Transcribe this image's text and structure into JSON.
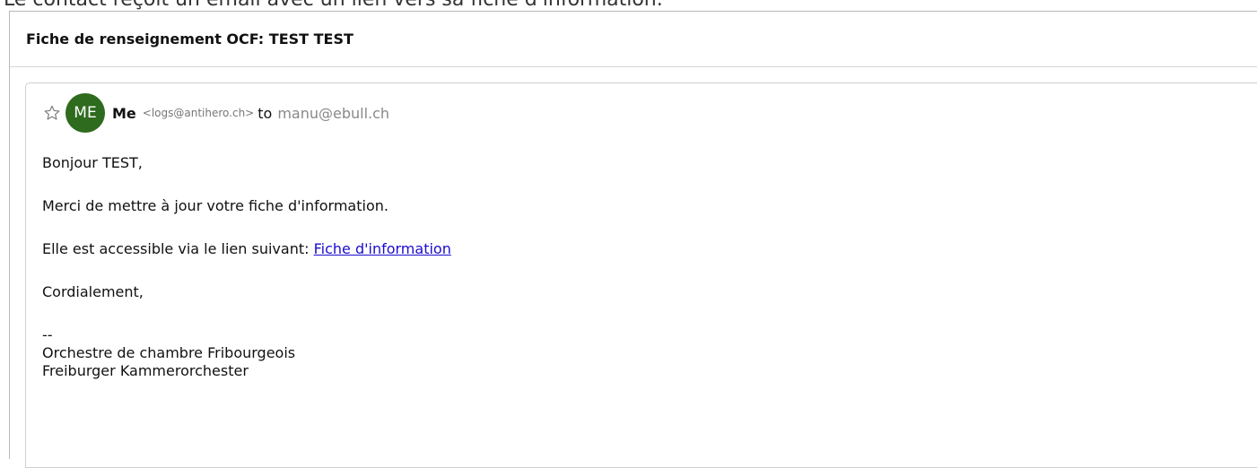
{
  "caption": "Le contact reçoit un email avec un lien vers sa fiche d'information.",
  "email": {
    "subject": "Fiche de renseignement OCF: TEST TEST",
    "avatar_initials": "ME",
    "sender_name": "Me",
    "sender_email": "<logs@antihero.ch>",
    "to_label": "to",
    "recipient": "manu@ebull.ch",
    "avatar_color": "#2e6b1e",
    "body": {
      "greeting": "Bonjour TEST,",
      "line1": "Merci de mettre à jour votre fiche d'information.",
      "line2_prefix": "Elle est accessible via le lien suivant:",
      "link_label": "Fiche d'information",
      "closing": "Cordialement,",
      "signature": {
        "separator": "--",
        "line1": "Orchestre de chambre Fribourgeois",
        "line2": "Freiburger Kammerorchester"
      }
    }
  },
  "icons": {
    "star": "star-outline-icon"
  }
}
